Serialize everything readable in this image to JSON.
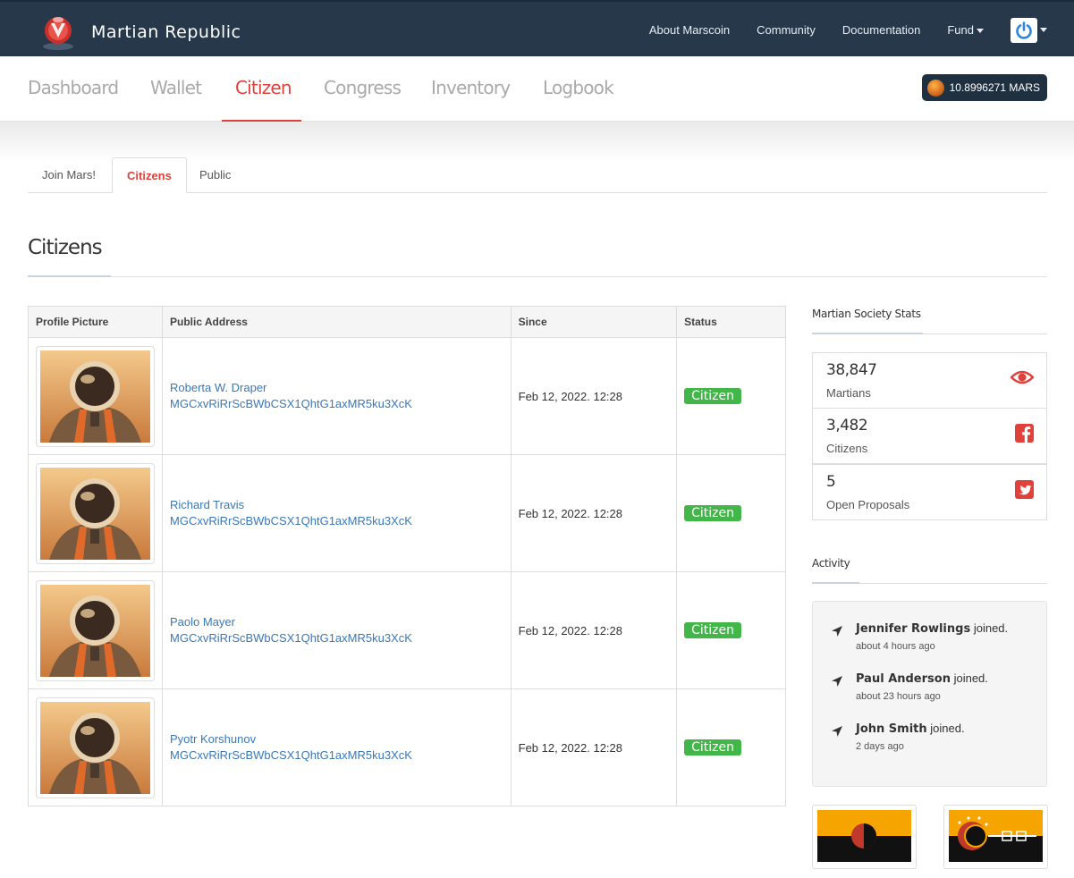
{
  "app": {
    "brand": "Martian Republic"
  },
  "topnav": {
    "items": [
      "About Marscoin",
      "Community",
      "Documentation",
      "Fund"
    ]
  },
  "subnav": {
    "items": [
      "Dashboard",
      "Wallet",
      "Citizen",
      "Congress",
      "Inventory",
      "Logbook"
    ],
    "active": "Citizen",
    "balance": "10.8996271 MARS"
  },
  "tabs": {
    "items": [
      "Join Mars!",
      "Citizens",
      "Public"
    ],
    "active": "Citizens"
  },
  "page": {
    "title": "Citizens"
  },
  "table": {
    "headers": [
      "Profile Picture",
      "Public Address",
      "Since",
      "Status"
    ],
    "rows": [
      {
        "name": "Roberta W. Draper",
        "address": "MGCxvRiRrScBWbCSX1QhtG1axMR5ku3XcK",
        "since": "Feb 12, 2022. 12:28",
        "status": "Citizen"
      },
      {
        "name": "Richard Travis",
        "address": "MGCxvRiRrScBWbCSX1QhtG1axMR5ku3XcK",
        "since": "Feb 12, 2022. 12:28",
        "status": "Citizen"
      },
      {
        "name": "Paolo Mayer",
        "address": "MGCxvRiRrScBWbCSX1QhtG1axMR5ku3XcK",
        "since": "Feb 12, 2022. 12:28",
        "status": "Citizen"
      },
      {
        "name": "Pyotr Korshunov",
        "address": "MGCxvRiRrScBWbCSX1QhtG1axMR5ku3XcK",
        "since": "Feb 12, 2022. 12:28",
        "status": "Citizen"
      }
    ]
  },
  "stats": {
    "title": "Martian Society Stats",
    "items": [
      {
        "value": "38,847",
        "label": "Martians",
        "icon": "eye-icon"
      },
      {
        "value": "3,482",
        "label": "Citizens",
        "icon": "facebook-square-icon"
      },
      {
        "value": "5",
        "label": "Open Proposals",
        "icon": "twitter-square-icon"
      }
    ]
  },
  "activity": {
    "title": "Activity",
    "items": [
      {
        "name": "Jennifer Rowlings",
        "action": "joined.",
        "time": "about 4 hours ago"
      },
      {
        "name": "Paul Anderson",
        "action": "joined.",
        "time": "about 23 hours ago"
      },
      {
        "name": "John Smith",
        "action": "joined.",
        "time": "2 days ago"
      }
    ]
  },
  "colors": {
    "navbar": "#26384a",
    "accent": "#e0413a",
    "badge": "#43b649",
    "link": "#3a78b7"
  }
}
